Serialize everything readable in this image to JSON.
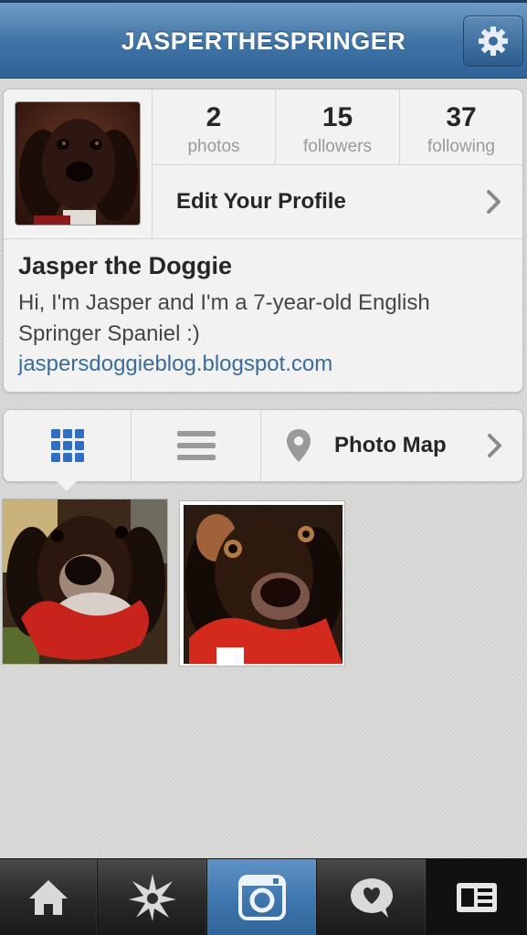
{
  "header": {
    "title": "JASPERTHESPRINGER",
    "settings_icon": "gear-icon"
  },
  "profile": {
    "stats": [
      {
        "value": "2",
        "label": "photos"
      },
      {
        "value": "15",
        "label": "followers"
      },
      {
        "value": "37",
        "label": "following"
      }
    ],
    "edit_label": "Edit Your Profile",
    "name": "Jasper the Doggie",
    "bio": "Hi, I'm Jasper and I'm a 7-year-old English Springer Spaniel :)",
    "website": "jaspersdoggieblog.blogspot.com"
  },
  "view_switcher": {
    "grid_icon": "grid-icon",
    "list_icon": "list-icon",
    "photo_map_label": "Photo Map"
  },
  "tabbar": {
    "items": [
      "home-icon",
      "explore-icon",
      "camera-icon",
      "activity-icon",
      "profile-icon"
    ],
    "active": "camera-icon"
  },
  "colors": {
    "header_blue": "#3f73a5",
    "link_blue": "#3a6c9c",
    "grid_icon_blue": "#2f6ec2"
  }
}
